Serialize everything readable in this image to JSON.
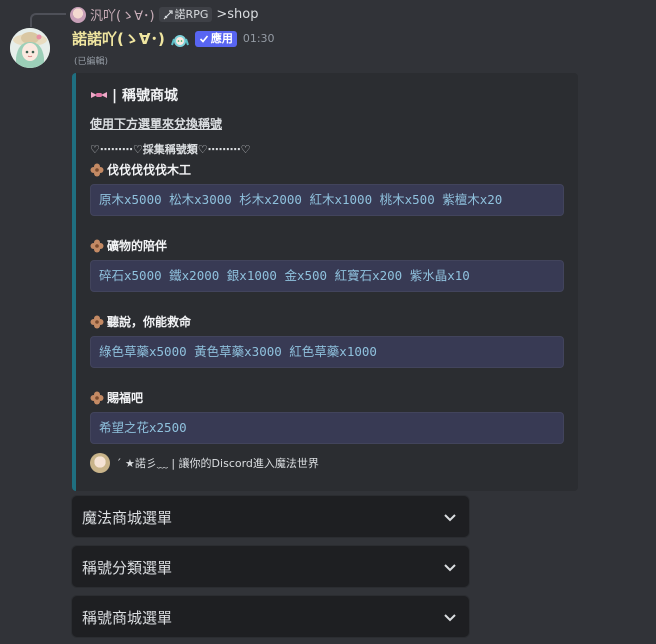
{
  "reply": {
    "author": "汎吖(ゝ∀･)",
    "bot_tag": "諾RPG",
    "command": ">shop"
  },
  "message": {
    "author": "諾諾吖(ゝ∀･)",
    "app_badge": "應用",
    "timestamp": "01:30",
    "edited_label": "(已編輯)"
  },
  "embed": {
    "accent_color": "#1f6f80",
    "title": "| 稱號商城",
    "description": "使用下方選單來兌換稱號",
    "divider": "♡⋯⋯⋯♡採集稱號類♡⋯⋯⋯♡",
    "fields": [
      {
        "name": "伐伐伐伐伐木工",
        "value": "原木x5000 松木x3000 杉木x2000 紅木x1000 桃木x500 紫檀木x20"
      },
      {
        "name": "礦物的陪伴",
        "value": "碎石x5000 鐵x2000 銀x1000 金x500 紅寶石x200 紫水晶x10"
      },
      {
        "name": "聽說，你能救命",
        "value": "綠色草藥x5000 黃色草藥x3000 紅色草藥x1000"
      },
      {
        "name": "賜福吧",
        "value": "希望之花x2500"
      }
    ],
    "footer": "ˊ ★諾彡﹏ | 讓你的Discord進入魔法世界"
  },
  "selects": [
    {
      "label": "魔法商城選單"
    },
    {
      "label": "稱號分類選單"
    },
    {
      "label": "稱號商城選單"
    }
  ],
  "icons": {
    "field_icon": "flower-icon",
    "title_icon": "ribbon-icon",
    "select_icon": "chevron-down-icon"
  }
}
